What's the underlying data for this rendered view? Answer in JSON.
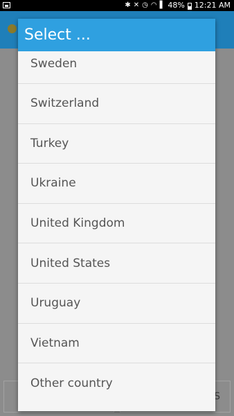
{
  "status_bar": {
    "battery": "48%",
    "time": "12:21 AM",
    "icons": [
      "bluetooth-icon",
      "mute-icon",
      "alarm-icon",
      "wifi-icon",
      "signal-icon",
      "battery-icon"
    ]
  },
  "background_app": {
    "bottom_right_text": "S"
  },
  "dialog": {
    "title": "Select ...",
    "items": [
      {
        "label": "Sweden"
      },
      {
        "label": "Switzerland"
      },
      {
        "label": "Turkey"
      },
      {
        "label": "Ukraine"
      },
      {
        "label": "United Kingdom"
      },
      {
        "label": "United States"
      },
      {
        "label": "Uruguay"
      },
      {
        "label": "Vietnam"
      },
      {
        "label": "Other country"
      }
    ]
  },
  "colors": {
    "header": "#2fa0e0",
    "app_bar": "#1f7fb9",
    "dialog_bg": "#f5f5f5",
    "divider": "#dcdcdc",
    "item_text": "#555555"
  }
}
